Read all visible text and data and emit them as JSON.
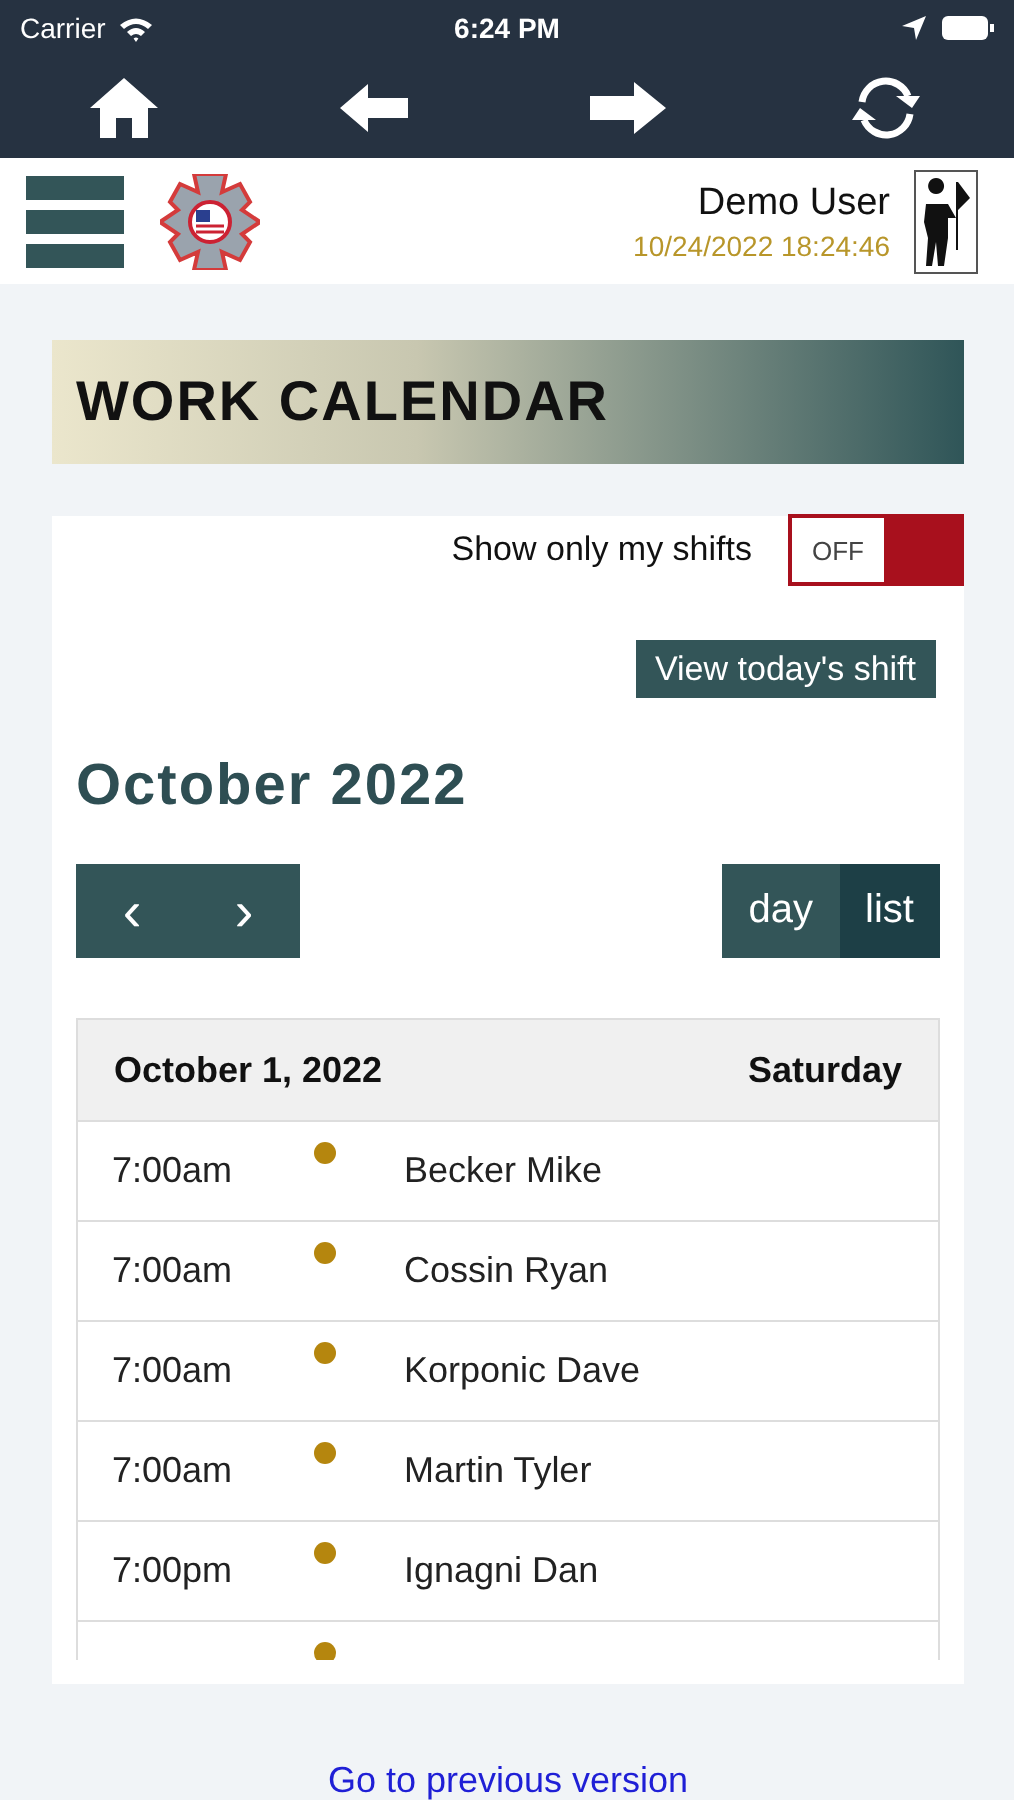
{
  "status_bar": {
    "carrier": "Carrier",
    "time": "6:24 PM"
  },
  "header": {
    "user_name": "Demo User",
    "timestamp": "10/24/2022 18:24:46"
  },
  "banner": {
    "title": "WORK CALENDAR"
  },
  "filter": {
    "label": "Show only my shifts",
    "toggle": {
      "on": false,
      "label": "OFF"
    }
  },
  "today_button": "View today's shift",
  "calendar": {
    "month_title": "October 2022",
    "prev": "‹",
    "next": "›",
    "views": [
      {
        "label": "day",
        "selected": false
      },
      {
        "label": "list",
        "selected": true
      }
    ],
    "day": {
      "date": "October 1, 2022",
      "weekday": "Saturday"
    },
    "events": [
      {
        "time": "7:00am",
        "name": "Becker Mike",
        "color": "#b5860e"
      },
      {
        "time": "7:00am",
        "name": "Cossin Ryan",
        "color": "#b5860e"
      },
      {
        "time": "7:00am",
        "name": "Korponic Dave",
        "color": "#b5860e"
      },
      {
        "time": "7:00am",
        "name": "Martin Tyler",
        "color": "#b5860e"
      },
      {
        "time": "7:00pm",
        "name": "Ignagni Dan",
        "color": "#b5860e"
      },
      {
        "color": "#b5860e"
      }
    ]
  },
  "footer_link": "Go to previous version"
}
